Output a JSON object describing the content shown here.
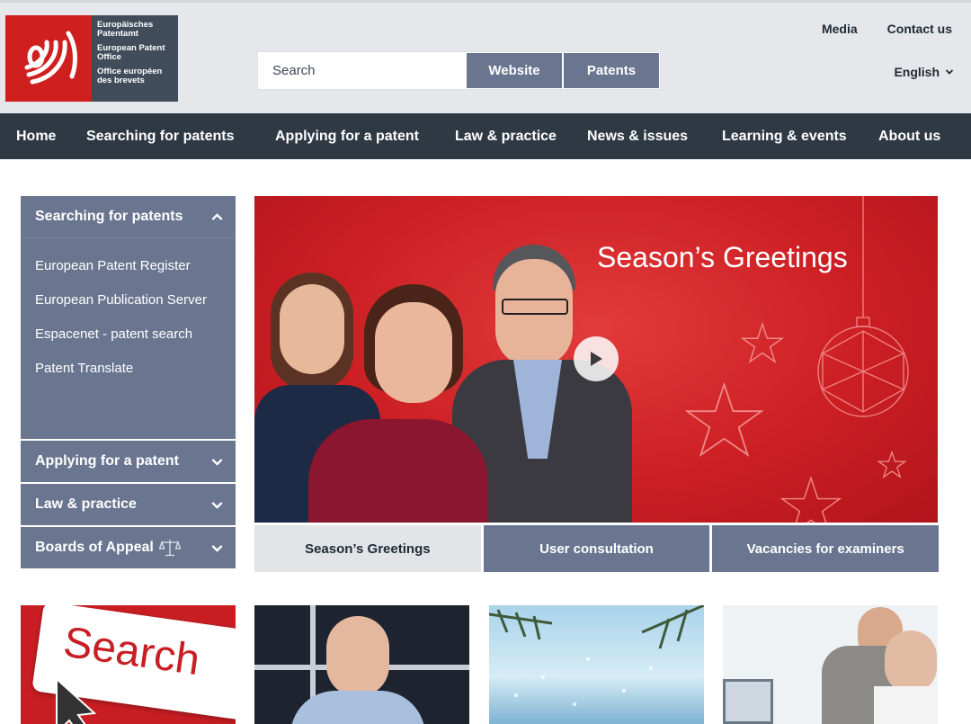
{
  "logo": {
    "lines_de": "Europäisches Patentamt",
    "lines_en": "European Patent Office",
    "lines_fr": "Office européen des brevets"
  },
  "search": {
    "placeholder": "Search",
    "website_label": "Website",
    "patents_label": "Patents"
  },
  "top_links": {
    "media": "Media",
    "contact": "Contact us"
  },
  "language": {
    "selected": "English"
  },
  "main_nav": [
    "Home",
    "Searching for patents",
    "Applying for a patent",
    "Law & practice",
    "News & issues",
    "Learning & events",
    "About us"
  ],
  "sidebar": {
    "active_section": "Searching for patents",
    "links": [
      "European Patent Register",
      "European Publication Server",
      "Espacenet - patent search",
      "Patent Translate"
    ],
    "sections": [
      "Applying for a patent",
      "Law & practice",
      "Boards of Appeal"
    ]
  },
  "hero": {
    "title": "Season’s Greetings",
    "tabs": [
      "Season’s Greetings",
      "User consultation",
      "Vacancies for examiners"
    ]
  },
  "tiles": {
    "search_word": "Search"
  },
  "colors": {
    "brand_red": "#cf1f1f",
    "nav_dark": "#2f3944",
    "sidebar_blue": "#6a7690"
  }
}
